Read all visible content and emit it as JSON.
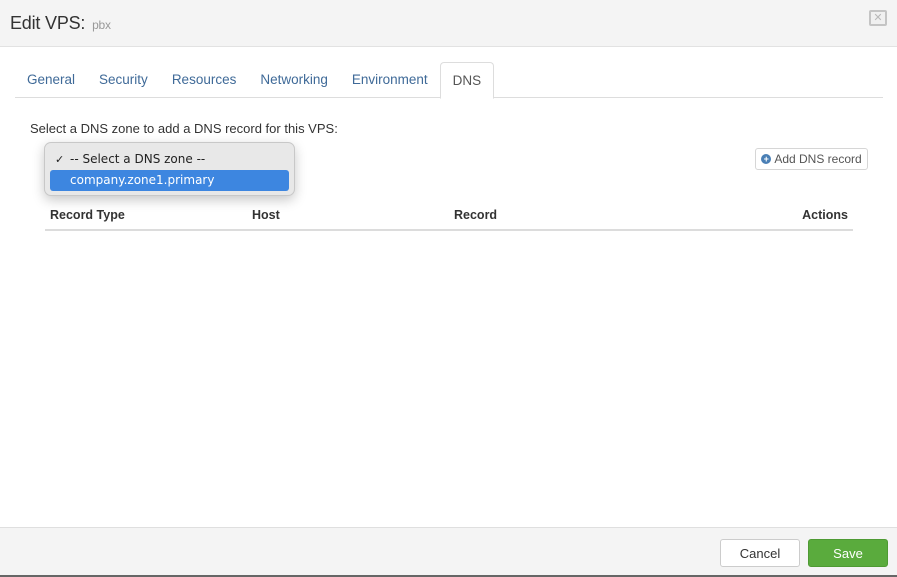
{
  "header": {
    "title": "Edit VPS:",
    "subtitle": "pbx",
    "close_icon": "close-icon"
  },
  "tabs": [
    {
      "label": "General",
      "active": false
    },
    {
      "label": "Security",
      "active": false
    },
    {
      "label": "Resources",
      "active": false
    },
    {
      "label": "Networking",
      "active": false
    },
    {
      "label": "Environment",
      "active": false
    },
    {
      "label": "DNS",
      "active": true
    }
  ],
  "dns": {
    "instruction": "Select a DNS zone to add a DNS record for this VPS:",
    "zone_select": {
      "options": [
        {
          "label": "-- Select a DNS zone --",
          "checked": true,
          "highlighted": false
        },
        {
          "label": "company.zone1.primary",
          "checked": false,
          "highlighted": true
        }
      ]
    },
    "add_button": {
      "label": "Add DNS record",
      "icon": "plus-circle-icon"
    },
    "table": {
      "columns": [
        "Record Type",
        "Host",
        "Record",
        "Actions"
      ],
      "rows": []
    }
  },
  "footer": {
    "cancel_label": "Cancel",
    "save_label": "Save"
  },
  "colors": {
    "save": "#5aab3d",
    "tab_link": "#3f6a98",
    "highlight": "#3d86e0"
  }
}
